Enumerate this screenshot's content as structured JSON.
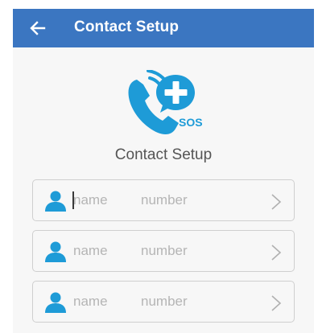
{
  "header": {
    "title": "Contact Setup",
    "back_icon": "back-arrow-icon",
    "background": "#3b76c1"
  },
  "logo": {
    "icon": "sos-phone-icon",
    "text": "SOS",
    "color": "#1e9bd7"
  },
  "section": {
    "title": "Contact Setup"
  },
  "contacts": [
    {
      "icon": "user-icon",
      "name_placeholder": "name",
      "number_placeholder": "number",
      "focused": true
    },
    {
      "icon": "user-icon",
      "name_placeholder": "name",
      "number_placeholder": "number",
      "focused": false
    },
    {
      "icon": "user-icon",
      "name_placeholder": "name",
      "number_placeholder": "number",
      "focused": false
    }
  ],
  "colors": {
    "accent": "#1e9bd7",
    "placeholder": "#b5b5b5",
    "border": "#cfcfcf"
  }
}
